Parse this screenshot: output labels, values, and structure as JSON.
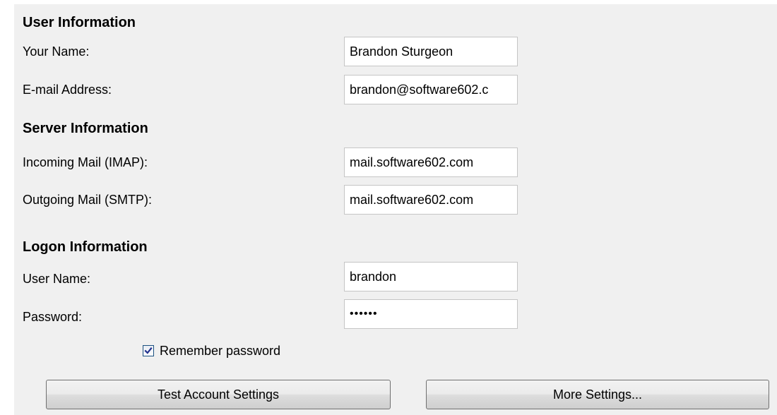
{
  "user_info": {
    "title": "User Information",
    "name_label": "Your Name:",
    "name_value": "Brandon Sturgeon",
    "email_label": "E-mail Address:",
    "email_value": "brandon@software602.c"
  },
  "server_info": {
    "title": "Server Information",
    "incoming_label": "Incoming Mail (IMAP):",
    "incoming_value": "mail.software602.com",
    "outgoing_label": "Outgoing Mail (SMTP):",
    "outgoing_value": "mail.software602.com"
  },
  "logon_info": {
    "title": "Logon Information",
    "username_label": "User Name:",
    "username_value": "brandon",
    "password_label": "Password:",
    "password_value": "••••••",
    "remember_label": "Remember password",
    "remember_checked": true
  },
  "buttons": {
    "test_label": "Test Account Settings",
    "more_label": "More Settings..."
  },
  "colors": {
    "panel_background": "#f0f0f0",
    "checkbox_border": "#1c5180",
    "checkmark": "#21318e"
  }
}
